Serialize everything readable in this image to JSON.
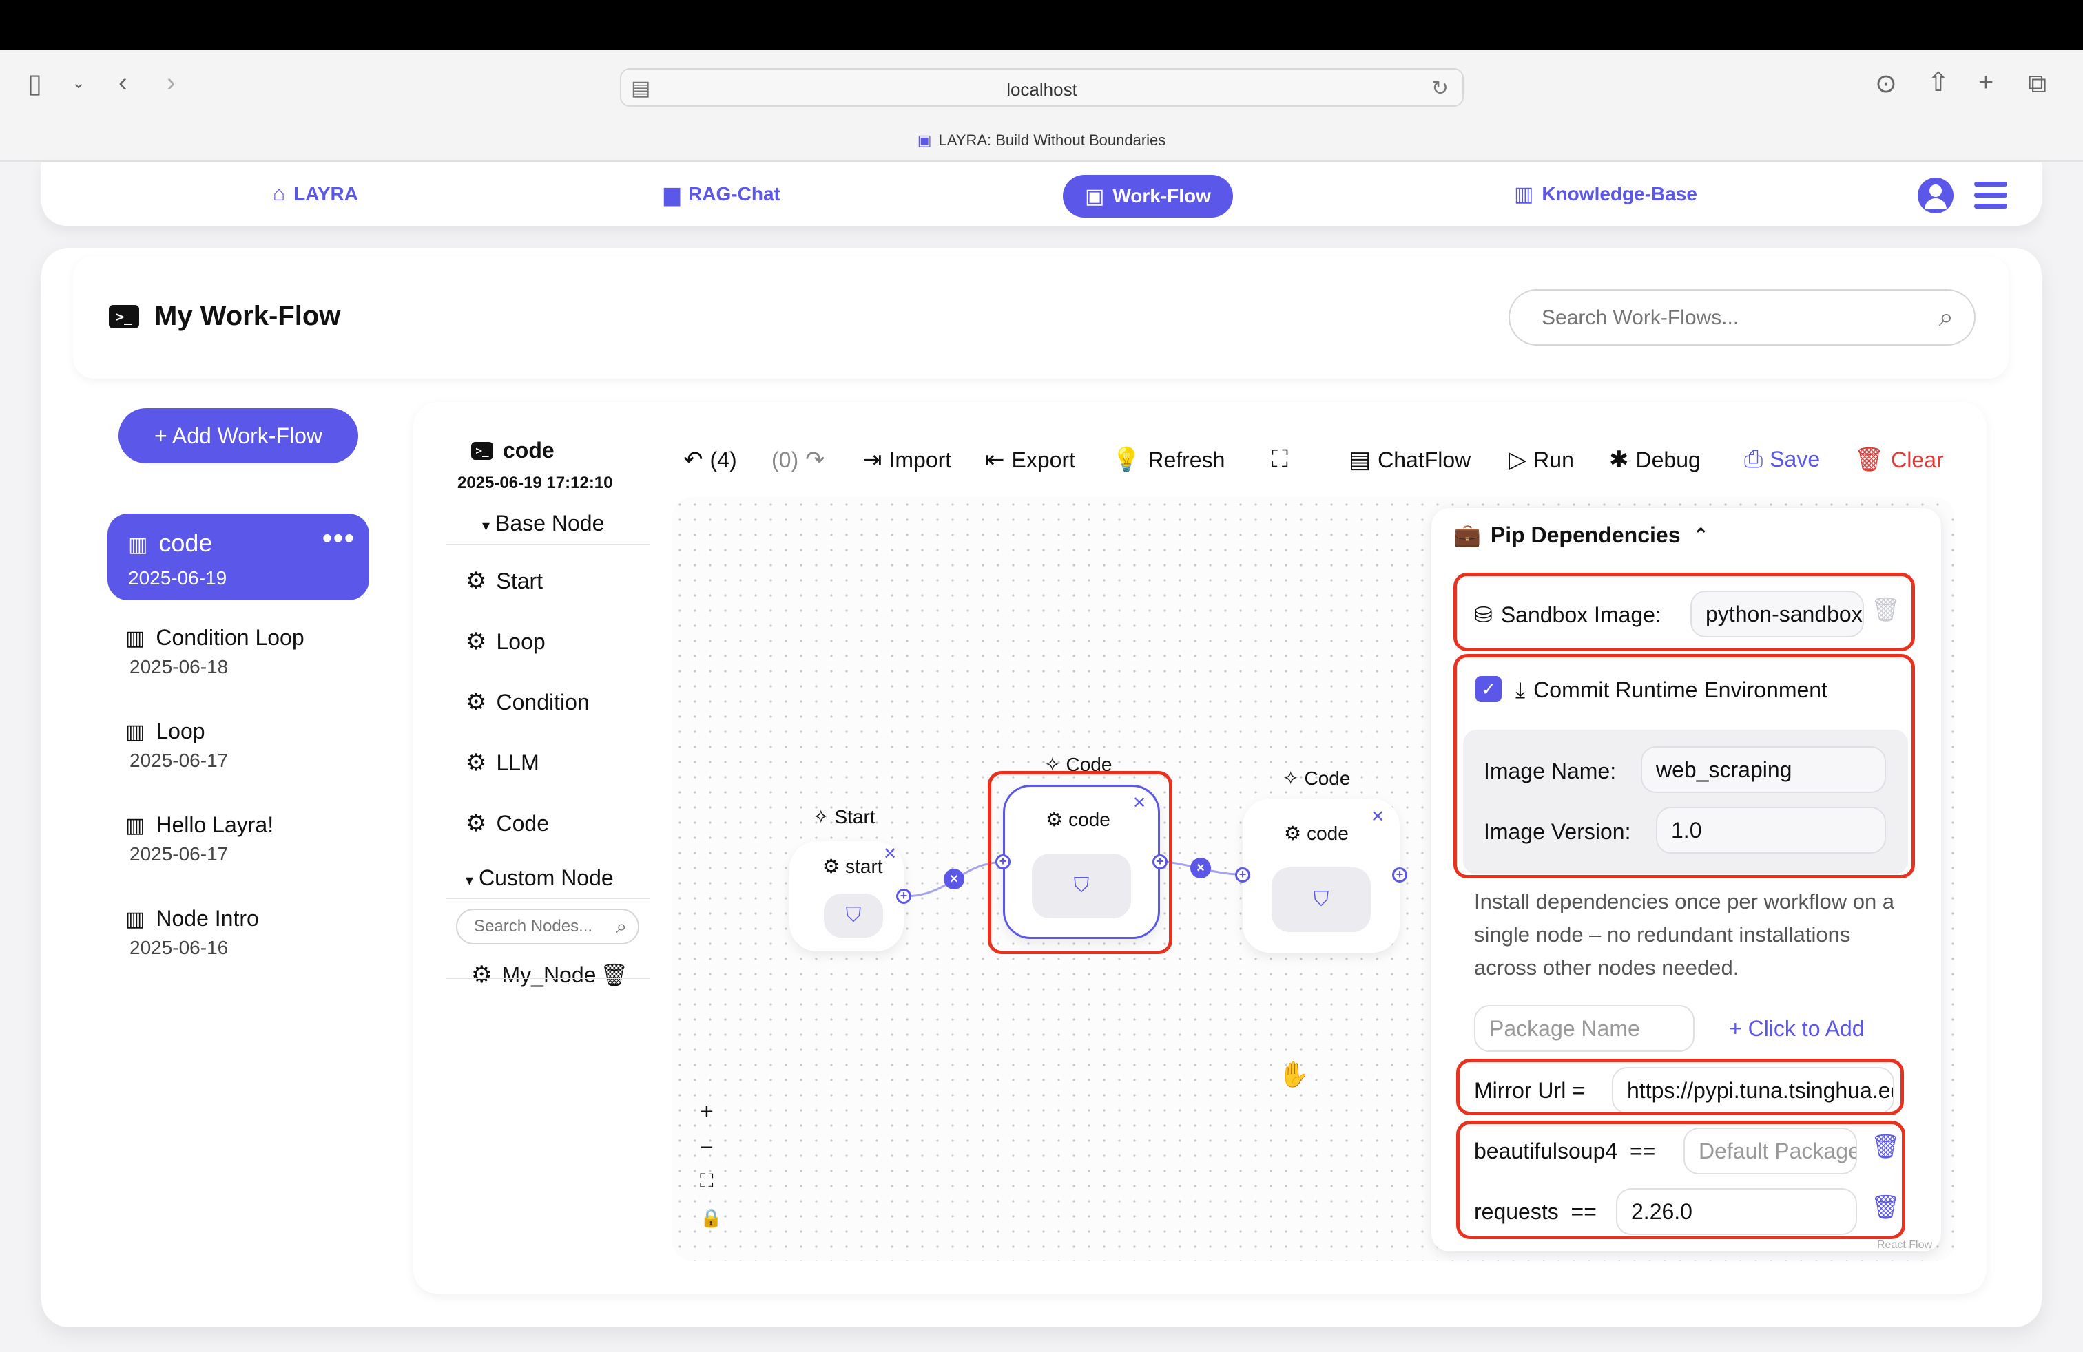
{
  "browser": {
    "url": "localhost",
    "tab_title": "LAYRA: Build Without Boundaries"
  },
  "nav": {
    "items": [
      {
        "label": "LAYRA",
        "icon": "home-icon"
      },
      {
        "label": "RAG-Chat",
        "icon": "chat-icon"
      },
      {
        "label": "Work-Flow",
        "icon": "terminal-icon"
      },
      {
        "label": "Knowledge-Base",
        "icon": "book-icon"
      }
    ],
    "active": "Work-Flow"
  },
  "page": {
    "title": "My Work-Flow",
    "search_placeholder": "Search Work-Flows..."
  },
  "sidebar": {
    "add_label": "+ Add Work-Flow",
    "active": {
      "name": "code",
      "date": "2025-06-19"
    },
    "items": [
      {
        "name": "Condition Loop",
        "date": "2025-06-18"
      },
      {
        "name": "Loop",
        "date": "2025-06-17"
      },
      {
        "name": "Hello Layra!",
        "date": "2025-06-17"
      },
      {
        "name": "Node Intro",
        "date": "2025-06-16"
      }
    ]
  },
  "palette": {
    "node_name": "code",
    "node_date": "2025-06-19 17:12:10",
    "base_header": "Base Node",
    "base_items": [
      "Start",
      "Loop",
      "Condition",
      "LLM",
      "Code"
    ],
    "custom_header": "Custom Node",
    "search_placeholder": "Search Nodes...",
    "custom_items": [
      "My_Node"
    ]
  },
  "toolbar": {
    "undo": "(4)",
    "redo": "(0)",
    "import": "Import",
    "export": "Export",
    "refresh": "Refresh",
    "chatflow": "ChatFlow",
    "run": "Run",
    "debug": "Debug",
    "save": "Save",
    "clear": "Clear"
  },
  "canvas": {
    "nodes": [
      {
        "type": "Start",
        "label": "start"
      },
      {
        "type": "Code",
        "label": "code"
      },
      {
        "type": "Code",
        "label": "code"
      }
    ],
    "zoom_in": "+",
    "zoom_out": "−",
    "attribution": "React Flow"
  },
  "pip": {
    "title": "Pip Dependencies",
    "sandbox_label": "Sandbox Image:",
    "sandbox_value": "python-sandbox",
    "commit_label": "Commit Runtime Environment",
    "commit_checked": true,
    "image_name_label": "Image Name:",
    "image_name_value": "web_scraping",
    "image_version_label": "Image Version:",
    "image_version_value": "1.0",
    "help": "Install dependencies once per workflow on a single node – no redundant installations across other nodes needed.",
    "package_placeholder": "Package Name",
    "add_label": "+ Click to Add",
    "mirror_label": "Mirror Url  =",
    "mirror_value": "https://pypi.tuna.tsinghua.edu.cn/simple",
    "packages": [
      {
        "name": "beautifulsoup4",
        "op": "==",
        "version": "",
        "placeholder": "Default Package"
      },
      {
        "name": "requests",
        "op": "==",
        "version": "2.26.0",
        "placeholder": ""
      }
    ]
  },
  "colors": {
    "accent": "#5b57e8",
    "danger": "#e53935",
    "highlight": "#e8311f"
  }
}
